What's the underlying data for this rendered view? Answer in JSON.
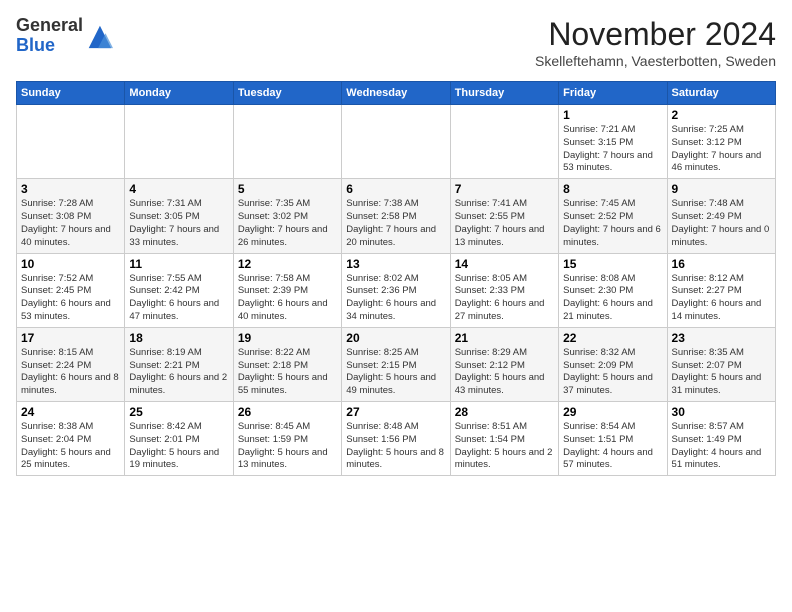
{
  "header": {
    "logo_line1": "General",
    "logo_line2": "Blue",
    "month_title": "November 2024",
    "subtitle": "Skelleftehamn, Vaesterbotten, Sweden"
  },
  "calendar": {
    "days_of_week": [
      "Sunday",
      "Monday",
      "Tuesday",
      "Wednesday",
      "Thursday",
      "Friday",
      "Saturday"
    ],
    "weeks": [
      [
        {
          "day": "",
          "info": ""
        },
        {
          "day": "",
          "info": ""
        },
        {
          "day": "",
          "info": ""
        },
        {
          "day": "",
          "info": ""
        },
        {
          "day": "",
          "info": ""
        },
        {
          "day": "1",
          "info": "Sunrise: 7:21 AM\nSunset: 3:15 PM\nDaylight: 7 hours\nand 53 minutes."
        },
        {
          "day": "2",
          "info": "Sunrise: 7:25 AM\nSunset: 3:12 PM\nDaylight: 7 hours\nand 46 minutes."
        }
      ],
      [
        {
          "day": "3",
          "info": "Sunrise: 7:28 AM\nSunset: 3:08 PM\nDaylight: 7 hours\nand 40 minutes."
        },
        {
          "day": "4",
          "info": "Sunrise: 7:31 AM\nSunset: 3:05 PM\nDaylight: 7 hours\nand 33 minutes."
        },
        {
          "day": "5",
          "info": "Sunrise: 7:35 AM\nSunset: 3:02 PM\nDaylight: 7 hours\nand 26 minutes."
        },
        {
          "day": "6",
          "info": "Sunrise: 7:38 AM\nSunset: 2:58 PM\nDaylight: 7 hours\nand 20 minutes."
        },
        {
          "day": "7",
          "info": "Sunrise: 7:41 AM\nSunset: 2:55 PM\nDaylight: 7 hours\nand 13 minutes."
        },
        {
          "day": "8",
          "info": "Sunrise: 7:45 AM\nSunset: 2:52 PM\nDaylight: 7 hours\nand 6 minutes."
        },
        {
          "day": "9",
          "info": "Sunrise: 7:48 AM\nSunset: 2:49 PM\nDaylight: 7 hours\nand 0 minutes."
        }
      ],
      [
        {
          "day": "10",
          "info": "Sunrise: 7:52 AM\nSunset: 2:45 PM\nDaylight: 6 hours\nand 53 minutes."
        },
        {
          "day": "11",
          "info": "Sunrise: 7:55 AM\nSunset: 2:42 PM\nDaylight: 6 hours\nand 47 minutes."
        },
        {
          "day": "12",
          "info": "Sunrise: 7:58 AM\nSunset: 2:39 PM\nDaylight: 6 hours\nand 40 minutes."
        },
        {
          "day": "13",
          "info": "Sunrise: 8:02 AM\nSunset: 2:36 PM\nDaylight: 6 hours\nand 34 minutes."
        },
        {
          "day": "14",
          "info": "Sunrise: 8:05 AM\nSunset: 2:33 PM\nDaylight: 6 hours\nand 27 minutes."
        },
        {
          "day": "15",
          "info": "Sunrise: 8:08 AM\nSunset: 2:30 PM\nDaylight: 6 hours\nand 21 minutes."
        },
        {
          "day": "16",
          "info": "Sunrise: 8:12 AM\nSunset: 2:27 PM\nDaylight: 6 hours\nand 14 minutes."
        }
      ],
      [
        {
          "day": "17",
          "info": "Sunrise: 8:15 AM\nSunset: 2:24 PM\nDaylight: 6 hours\nand 8 minutes."
        },
        {
          "day": "18",
          "info": "Sunrise: 8:19 AM\nSunset: 2:21 PM\nDaylight: 6 hours\nand 2 minutes."
        },
        {
          "day": "19",
          "info": "Sunrise: 8:22 AM\nSunset: 2:18 PM\nDaylight: 5 hours\nand 55 minutes."
        },
        {
          "day": "20",
          "info": "Sunrise: 8:25 AM\nSunset: 2:15 PM\nDaylight: 5 hours\nand 49 minutes."
        },
        {
          "day": "21",
          "info": "Sunrise: 8:29 AM\nSunset: 2:12 PM\nDaylight: 5 hours\nand 43 minutes."
        },
        {
          "day": "22",
          "info": "Sunrise: 8:32 AM\nSunset: 2:09 PM\nDaylight: 5 hours\nand 37 minutes."
        },
        {
          "day": "23",
          "info": "Sunrise: 8:35 AM\nSunset: 2:07 PM\nDaylight: 5 hours\nand 31 minutes."
        }
      ],
      [
        {
          "day": "24",
          "info": "Sunrise: 8:38 AM\nSunset: 2:04 PM\nDaylight: 5 hours\nand 25 minutes."
        },
        {
          "day": "25",
          "info": "Sunrise: 8:42 AM\nSunset: 2:01 PM\nDaylight: 5 hours\nand 19 minutes."
        },
        {
          "day": "26",
          "info": "Sunrise: 8:45 AM\nSunset: 1:59 PM\nDaylight: 5 hours\nand 13 minutes."
        },
        {
          "day": "27",
          "info": "Sunrise: 8:48 AM\nSunset: 1:56 PM\nDaylight: 5 hours\nand 8 minutes."
        },
        {
          "day": "28",
          "info": "Sunrise: 8:51 AM\nSunset: 1:54 PM\nDaylight: 5 hours\nand 2 minutes."
        },
        {
          "day": "29",
          "info": "Sunrise: 8:54 AM\nSunset: 1:51 PM\nDaylight: 4 hours\nand 57 minutes."
        },
        {
          "day": "30",
          "info": "Sunrise: 8:57 AM\nSunset: 1:49 PM\nDaylight: 4 hours\nand 51 minutes."
        }
      ]
    ]
  }
}
